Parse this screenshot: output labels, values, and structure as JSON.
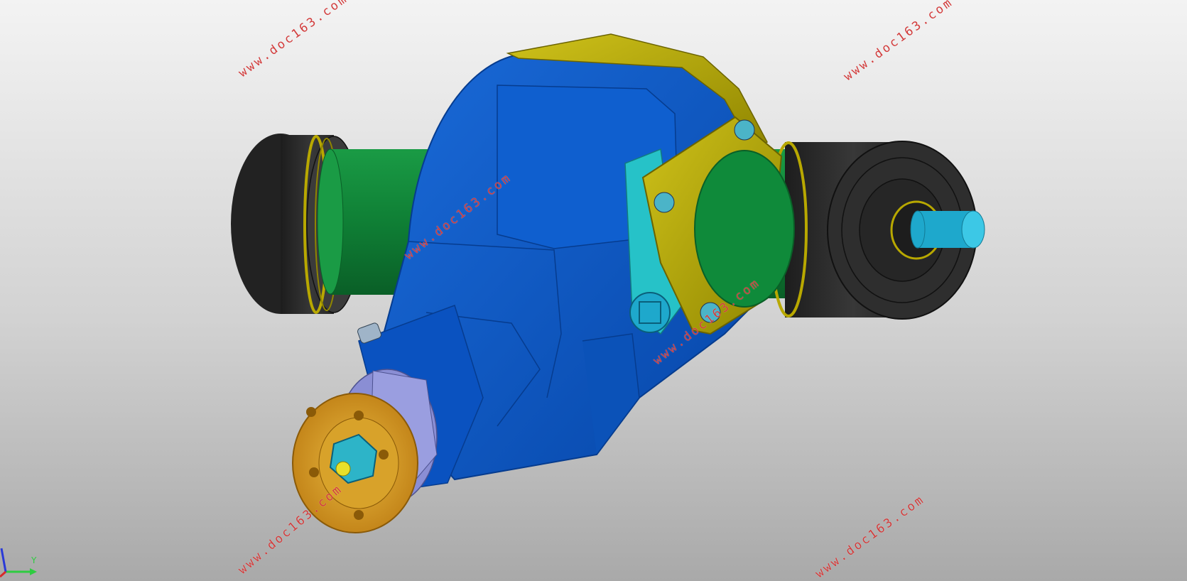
{
  "viewport": {
    "model": "gearbox-assembly",
    "background": "#cfcfcf"
  },
  "colors": {
    "housing": "#0a59c8",
    "housing_dark": "#063c8f",
    "shaft_green": "#0f8a3a",
    "drum_black": "#2a2a2a",
    "flange_yellow": "#b4a800",
    "flange_orange": "#d79a1e",
    "collar_lavender": "#8a8ed4",
    "cyan_shaft": "#26b8d8",
    "watermark": "#d23a3a"
  },
  "watermarks": [
    {
      "text": "www.doc163.com"
    },
    {
      "text": "www.doc163.com"
    },
    {
      "text": "www.doc163.com"
    },
    {
      "text": "www.doc163.com"
    },
    {
      "text": "www.doc163.com"
    },
    {
      "text": "www.doc163.com"
    }
  ],
  "triad": {
    "y_label": "Y"
  }
}
